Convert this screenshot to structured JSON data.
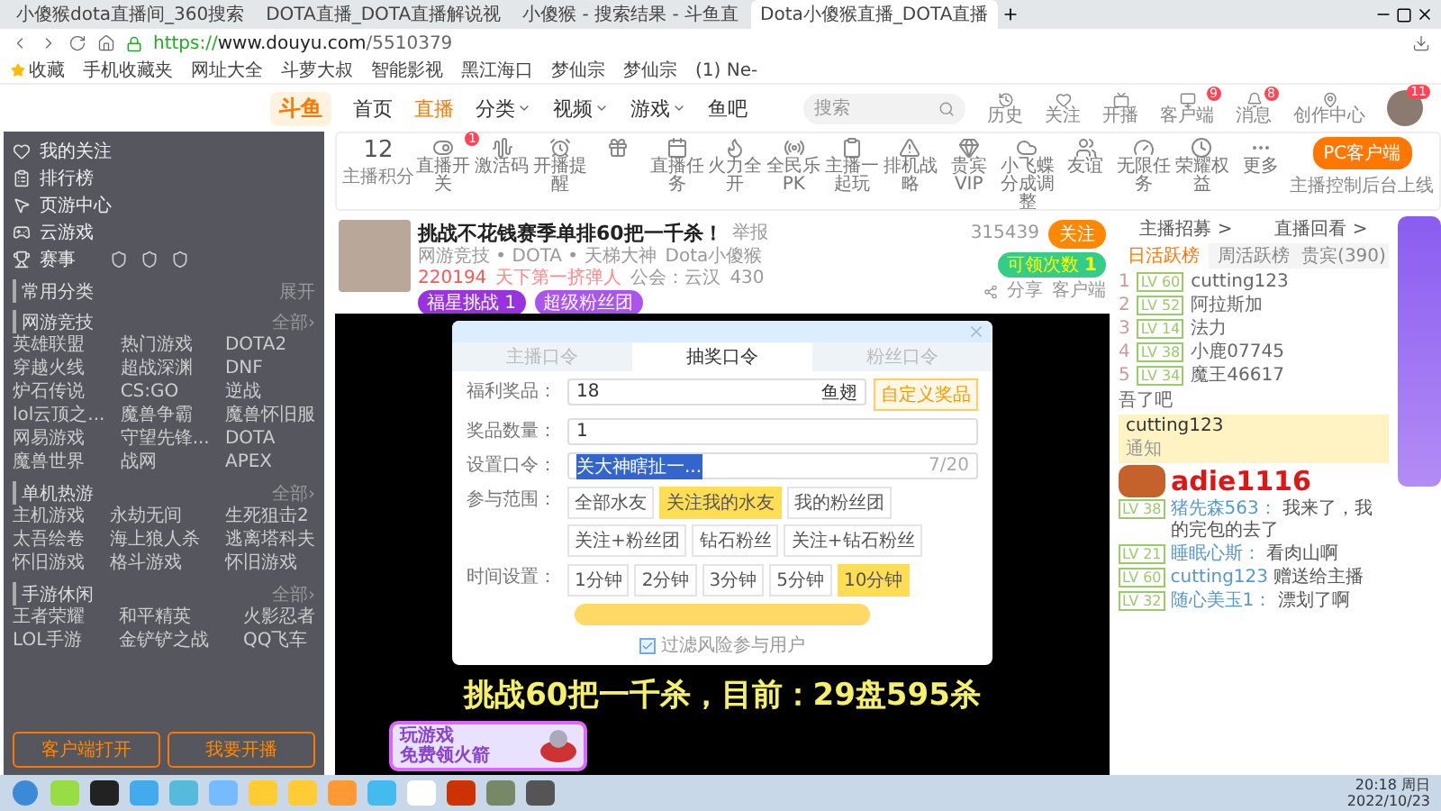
{
  "browser": {
    "tabs": [
      {
        "title": "小傻猴dota直播间_360搜索",
        "selected": false
      },
      {
        "title": "DOTA直播_DOTA直播解说视",
        "selected": false
      },
      {
        "title": "小傻猴 - 搜索结果 - 斗鱼直",
        "selected": false
      },
      {
        "title": "Dota小傻猴直播_DOTA直播",
        "selected": true
      }
    ],
    "address": {
      "scheme": "https://",
      "host": "www.douyu.com",
      "path": "/5510379"
    },
    "bookmarks": [
      "收藏",
      "手机收藏夹",
      "网址大全",
      "斗萝大叔",
      "智能影视",
      "黑江海口",
      "梦仙宗",
      "梦仙宗",
      "(1) Ne-"
    ]
  },
  "site_nav": {
    "logo": "斗鱼",
    "items": [
      {
        "label": "首页",
        "selected": false,
        "dropdown": false
      },
      {
        "label": "直播",
        "selected": true,
        "dropdown": false
      },
      {
        "label": "分类",
        "selected": false,
        "dropdown": true
      },
      {
        "label": "视频",
        "selected": false,
        "dropdown": true
      },
      {
        "label": "游戏",
        "selected": false,
        "dropdown": true
      },
      {
        "label": "鱼吧",
        "selected": false,
        "dropdown": false
      }
    ],
    "search_placeholder": "搜索",
    "shortcuts": [
      {
        "label": "历史"
      },
      {
        "label": "关注"
      },
      {
        "label": "开播"
      },
      {
        "label": "客户端",
        "badge": "9"
      },
      {
        "label": "消息",
        "badge": "8"
      },
      {
        "label": "创作中心"
      }
    ],
    "avatar_badge": "11"
  },
  "toolbar": {
    "score": "12",
    "score_label": "主播积分",
    "items": [
      {
        "kind": "labeled",
        "label": "直播开关",
        "badge": "1"
      },
      {
        "kind": "labeled",
        "label": "激活码"
      },
      {
        "kind": "labeled",
        "label": "开播提醒"
      },
      {
        "kind": "icon"
      },
      {
        "kind": "labeled",
        "label": "直播任务"
      },
      {
        "kind": "labeled",
        "label": "火力全开"
      },
      {
        "kind": "labeled",
        "label": "全民乐PK"
      },
      {
        "kind": "labeled",
        "label": "主播一起玩"
      },
      {
        "kind": "labeled",
        "label": "排机战略"
      },
      {
        "kind": "labeled",
        "label": "贵宾VIP"
      },
      {
        "kind": "labeled",
        "label": "小飞蝶分成调整"
      },
      {
        "kind": "labeled",
        "label": "友谊"
      },
      {
        "kind": "labeled",
        "label": "无限任务"
      },
      {
        "kind": "labeled",
        "label": "荣耀权益"
      },
      {
        "kind": "labeled",
        "label": "更多"
      }
    ],
    "client_button": "PC客户端",
    "client_note": "主播控制后台上线"
  },
  "sidebar": {
    "top_items": [
      "我的关注",
      "排行榜",
      "页游中心",
      "云游戏",
      "赛事"
    ],
    "common": {
      "title": "常用分类",
      "action": "展开"
    },
    "sections": [
      {
        "title": "网游竞技",
        "action": "全部›",
        "items": [
          "英雄联盟",
          "热门游戏",
          "DOTA2",
          "穿越火线",
          "超战深渊",
          "DNF",
          "炉石传说",
          "CS:GO",
          "逆战",
          "lol云顶之...",
          "魔兽争霸",
          "魔兽怀旧服",
          "网易游戏",
          "守望先锋...",
          "DOTA",
          "魔兽世界",
          "战网",
          "APEX"
        ]
      },
      {
        "title": "单机热游",
        "action": "全部›",
        "items": [
          "主机游戏",
          "永劫无间",
          "生死狙击2",
          "太吾绘卷",
          "海上狼人杀",
          "逃离塔科夫",
          "怀旧游戏",
          "格斗游戏",
          "怀旧游戏"
        ]
      },
      {
        "title": "手游休闲",
        "action": "全部›",
        "items": [
          "王者荣耀",
          "和平精英",
          "火影忍者",
          "LOL手游",
          "金铲铲之战",
          "QQ飞车"
        ]
      }
    ],
    "buttons": [
      "客户端打开",
      "我要开播"
    ]
  },
  "stream": {
    "title": "挑战不花钱赛季单排60把一千杀！",
    "report": "举报",
    "category": "网游竞技 • DOTA • 天梯大神",
    "streamer": "Dota小傻猴",
    "heat": "220194",
    "rank": "天下第一挤弹人",
    "guild": "公会：云汉",
    "members": "430",
    "tags": [
      {
        "label": "福星挑战",
        "count": "1"
      },
      {
        "label": "超级粉丝团"
      }
    ],
    "followers": "315439",
    "follow": "关注",
    "claim": "可领次数",
    "claim_count": "1",
    "share": "分享",
    "client": "客户端"
  },
  "video": {
    "overlay": "挑战60把一千杀，目前：29盘595杀",
    "promo": [
      "玩游戏",
      "免费领火箭"
    ]
  },
  "modal": {
    "tabs": [
      {
        "label": "主播口令",
        "selected": false
      },
      {
        "label": "抽奖口令",
        "selected": true
      },
      {
        "label": "粉丝口令",
        "selected": false
      }
    ],
    "prize_label": "福利奖品：",
    "prize_value": "18",
    "prize_unit": "鱼翅",
    "custom_prize": "自定义奖品",
    "count_label": "奖品数量：",
    "count_value": "1",
    "code_label": "设置口令：",
    "code_value": "关大神瞎扯一...",
    "code_counter": "7/20",
    "range_label": "参与范围：",
    "range": [
      {
        "label": "全部水友",
        "selected": false
      },
      {
        "label": "关注我的水友",
        "selected": true
      },
      {
        "label": "我的粉丝团",
        "selected": false
      },
      {
        "label": "关注+粉丝团",
        "selected": false
      },
      {
        "label": "钻石粉丝",
        "selected": false
      },
      {
        "label": "关注+钻石粉丝",
        "selected": false
      }
    ],
    "time_label": "时间设置：",
    "times": [
      {
        "label": "1分钟",
        "selected": false
      },
      {
        "label": "2分钟",
        "selected": false
      },
      {
        "label": "3分钟",
        "selected": false
      },
      {
        "label": "5分钟",
        "selected": false
      },
      {
        "label": "10分钟",
        "selected": true
      }
    ],
    "filter": {
      "label": "过滤风险参与用户",
      "checked": true
    }
  },
  "chat": {
    "links": [
      "主播招募 >",
      "直播回看 >"
    ],
    "tabs": [
      {
        "label": "日活跃榜",
        "selected": true
      },
      {
        "label": "周活跃榜",
        "selected": false
      },
      {
        "label": "贵宾(390)",
        "selected": false
      }
    ],
    "ranks": [
      {
        "rank": "1",
        "level": "LV 60",
        "name": "cutting123"
      },
      {
        "rank": "2",
        "level": "LV 52",
        "name": "阿拉斯加"
      },
      {
        "rank": "3",
        "level": "LV 14",
        "name": "法力"
      },
      {
        "rank": "4",
        "level": "LV 38",
        "name": "小鹿07745"
      },
      {
        "rank": "5",
        "level": "LV 34",
        "name": "魔王46617"
      }
    ],
    "notice": "吾了吧",
    "banner": {
      "name": "cutting123",
      "note": "通知"
    },
    "sticker": "adie1116",
    "messages": [
      {
        "level": "LV 38",
        "user": "猪先森563：",
        "text": "我来了，我的完包的去了"
      },
      {
        "level": "LV 21",
        "user": "睡眠心斯：",
        "text": "看肉山啊"
      },
      {
        "level": "LV 60",
        "user": "cutting123",
        "text": "赠送给主播"
      },
      {
        "level": "LV 32",
        "user": "随心美玉1：",
        "text": "漂划了啊"
      }
    ]
  },
  "taskbar": {
    "time": "20:18 周日",
    "date": "2022/10/23"
  }
}
